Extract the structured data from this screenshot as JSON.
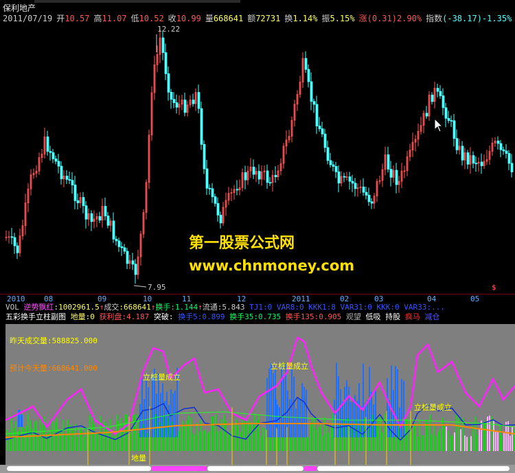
{
  "window": {
    "title": "保利地产"
  },
  "quote_bar": {
    "date": "2011/07/19",
    "open_label": "开",
    "open": "10.57",
    "high_label": "高",
    "high": "11.07",
    "low_label": "低",
    "low": "10.52",
    "close_label": "收",
    "close": "10.99",
    "volume_label": "量",
    "volume": "668641",
    "amount_label": "额",
    "amount": "72731",
    "turnover_label": "换",
    "turnover": "1.14%",
    "amplitude_label": "振",
    "amplitude": "5.15%",
    "change_label": "涨",
    "change": "(0.31)2.90%",
    "index_label": "指数",
    "index": "(-38.17)-1.35%"
  },
  "price_chart": {
    "max_price": "12.22",
    "min_price": "7.95",
    "dollar_marker": "$"
  },
  "x_axis": {
    "labels": [
      "2010",
      "08",
      "09",
      "10",
      "11",
      "12",
      "2011",
      "02",
      "03",
      "04",
      "05"
    ]
  },
  "volume_bar": {
    "vol_label": "VOL",
    "trend_label": "逆势飘红",
    "trend_value": ":1002961.5",
    "deal_label": "成交",
    "deal_value": ":668641",
    "hand_label": "换手",
    "hand_value": ":1.144",
    "float_label": "流通",
    "float_value": ":5.843",
    "tail": "TJ1:0 VAR8:0 KKK1:8 VAR31:0 KKK:0 VAR33:..."
  },
  "sub_title": {
    "name": "五彩换手立柱副图",
    "items": [
      "地量:0",
      "获利盘:4.187",
      "突破:",
      "换手5:0.899",
      "换手35:0.735",
      "换手135:0.905",
      "观望",
      "低吸",
      "持股",
      "疯马",
      "减仓"
    ]
  },
  "sub_panel": {
    "yesterday_label": "昨天成交量:588825.000",
    "today_label": "预计今天量:668641.000",
    "annotation": "立桩量成立",
    "low_volume_label": "地量"
  },
  "watermark": {
    "line1": "第一股票公式网",
    "line2": "www.chnmoney.com"
  },
  "colors": {
    "up": "#ff5555",
    "down": "#55ffff",
    "magenta": "#ff00ff",
    "yellow": "#ffff00",
    "green": "#00cc00",
    "blue": "#0066ff",
    "orange": "#ff8800"
  }
}
